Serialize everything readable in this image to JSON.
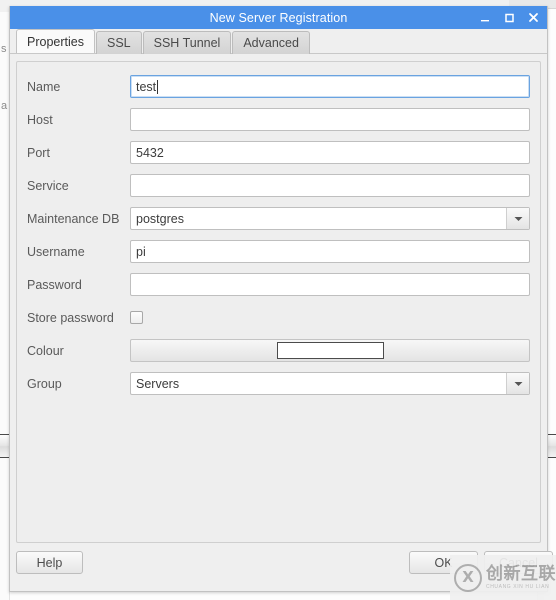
{
  "window": {
    "title": "New Server Registration",
    "controls": [
      {
        "name": "minimize",
        "glyph": "_"
      },
      {
        "name": "maximize",
        "glyph": "□"
      },
      {
        "name": "close",
        "glyph": "✕"
      }
    ],
    "title_bar_color": "#4a90e8"
  },
  "tabs": [
    {
      "label": "Properties",
      "active": true
    },
    {
      "label": "SSL",
      "active": false
    },
    {
      "label": "SSH Tunnel",
      "active": false
    },
    {
      "label": "Advanced",
      "active": false
    }
  ],
  "form": {
    "name": {
      "label": "Name",
      "value": "test",
      "placeholder": "",
      "focused": true
    },
    "host": {
      "label": "Host",
      "value": "",
      "placeholder": ""
    },
    "port": {
      "label": "Port",
      "value": "5432",
      "placeholder": ""
    },
    "service": {
      "label": "Service",
      "value": "",
      "placeholder": ""
    },
    "maintenance_db": {
      "label": "Maintenance DB",
      "value": "postgres"
    },
    "username": {
      "label": "Username",
      "value": "pi",
      "placeholder": ""
    },
    "password": {
      "label": "Password",
      "value": "",
      "placeholder": ""
    },
    "store_password": {
      "label": "Store password",
      "checked": false
    },
    "colour": {
      "label": "Colour",
      "swatch_color": "#ffffff"
    },
    "group": {
      "label": "Group",
      "value": "Servers"
    }
  },
  "buttons": {
    "help": "Help",
    "ok": "OK",
    "cancel": "Cancel"
  },
  "background": {
    "left_fragment_1": "s",
    "left_fragment_2": "a"
  },
  "watermark": {
    "mark": "X",
    "chinese": "创新互联",
    "pinyin": "CHUANG XIN HU LIAN"
  }
}
